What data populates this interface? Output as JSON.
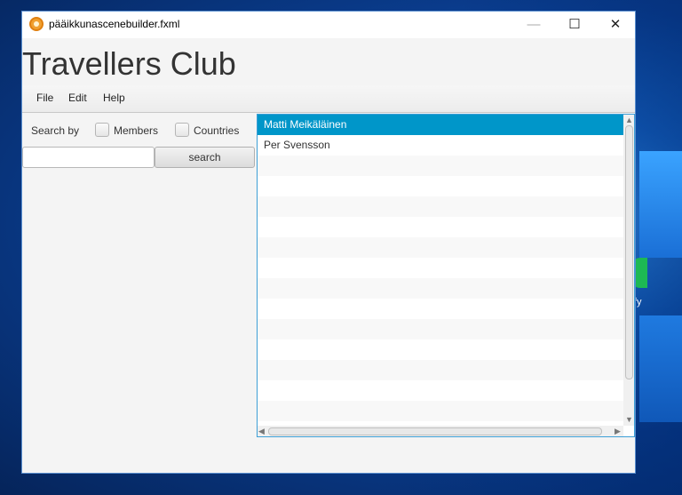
{
  "window": {
    "title": "pääikkunascenebuilder.fxml",
    "controls": {
      "minimize": "—",
      "maximize": "☐",
      "close": "✕"
    }
  },
  "app": {
    "title": "Travellers Club"
  },
  "menu": {
    "items": [
      "File",
      "Edit",
      "Help"
    ]
  },
  "search": {
    "label": "Search by",
    "members_label": "Members",
    "countries_label": "Countries",
    "members_checked": false,
    "countries_checked": false,
    "input_value": "",
    "button_label": "search"
  },
  "list": {
    "items": [
      "Matti Meikäläinen",
      "Per Svensson"
    ],
    "selected_index": 0,
    "colors": {
      "selection": "#0096c9",
      "focus_border": "#3d9fd6"
    }
  },
  "desktop": {
    "icon_name": "spotify-icon",
    "icon_label_fragment": "fy"
  }
}
